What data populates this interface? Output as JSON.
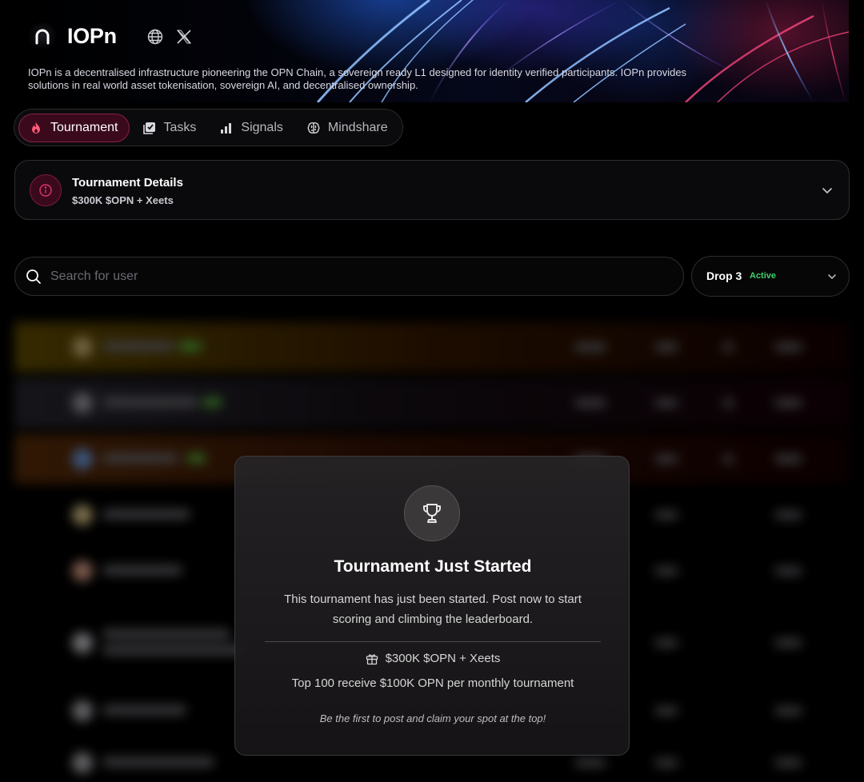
{
  "project": {
    "name": "IOPn",
    "description": "IOPn is a decentralised infrastructure pioneering the OPN Chain, a sovereign ready L1 designed for identity verified participants. IOPn provides solutions in real world asset tokenisation, sovereign AI, and decentralised ownership.",
    "logo_icon": "iopn-logo-icon",
    "social_icons": [
      "globe-icon",
      "x-icon"
    ]
  },
  "tabs": [
    {
      "label": "Tournament",
      "icon": "flame-icon",
      "active": true
    },
    {
      "label": "Tasks",
      "icon": "checkbox-stack-icon",
      "active": false
    },
    {
      "label": "Signals",
      "icon": "bar-chart-icon",
      "active": false
    },
    {
      "label": "Mindshare",
      "icon": "brain-icon",
      "active": false
    }
  ],
  "details": {
    "title": "Tournament Details",
    "subtitle": "$300K $OPN + Xeets"
  },
  "search": {
    "placeholder": "Search for user"
  },
  "drop": {
    "label": "Drop 3",
    "status": "Active",
    "status_color": "#3fd16a"
  },
  "modal": {
    "title": "Tournament Just Started",
    "body": "This tournament has just been started. Post now to start scoring and climbing the leaderboard.",
    "prize": "$300K $OPN + Xeets",
    "top_reward": "Top 100 receive $100K OPN per monthly tournament",
    "cta": "Be the first to post and claim your spot at the top!"
  },
  "colors": {
    "accent": "#8a1f47",
    "accent_bg": "#3a0a1c",
    "background": "#000000"
  }
}
